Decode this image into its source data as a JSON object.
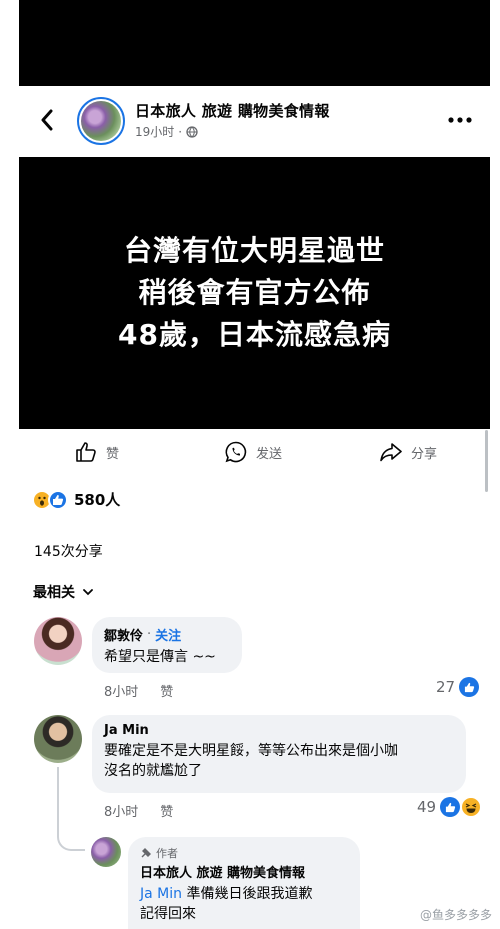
{
  "header": {
    "page_name": "日本旅人 旅遊 購物美食情報",
    "time": "19小时",
    "audience_icon": "globe-icon",
    "back_icon": "back-arrow-icon",
    "more_icon": "more-horizontal-icon"
  },
  "post_image": {
    "lines": [
      "台灣有位大明星過世",
      "稍後會有官方公佈",
      "48歲，日本流感急病"
    ]
  },
  "actions": {
    "like_label": "赞",
    "send_label": "发送",
    "share_label": "分享"
  },
  "reactions": {
    "count": "580人",
    "icons": [
      "wow-reaction-icon",
      "like-reaction-icon"
    ]
  },
  "share_count": "145次分享",
  "sort": {
    "label": "最相关"
  },
  "comments": [
    {
      "author": "鄒敦伶",
      "follow": "关注",
      "text": "希望只是傳言 ~~",
      "time": "8小时",
      "like_label": "赞",
      "reaction_count": "27"
    },
    {
      "author": "Ja Min",
      "text_line1": "要確定是不是大明星餒，等等公布出來是個小咖",
      "text_line2": "沒名的就尷尬了",
      "time": "8小时",
      "like_label": "赞",
      "reaction_count": "49"
    }
  ],
  "reply": {
    "author_tag": "作者",
    "author": "日本旅人 旅遊 購物美食情報",
    "mention": "Ja Min",
    "text_line1": " 準備幾日後跟我道歉",
    "text_line2": "記得回來"
  },
  "watermark": "@鱼多多多多"
}
